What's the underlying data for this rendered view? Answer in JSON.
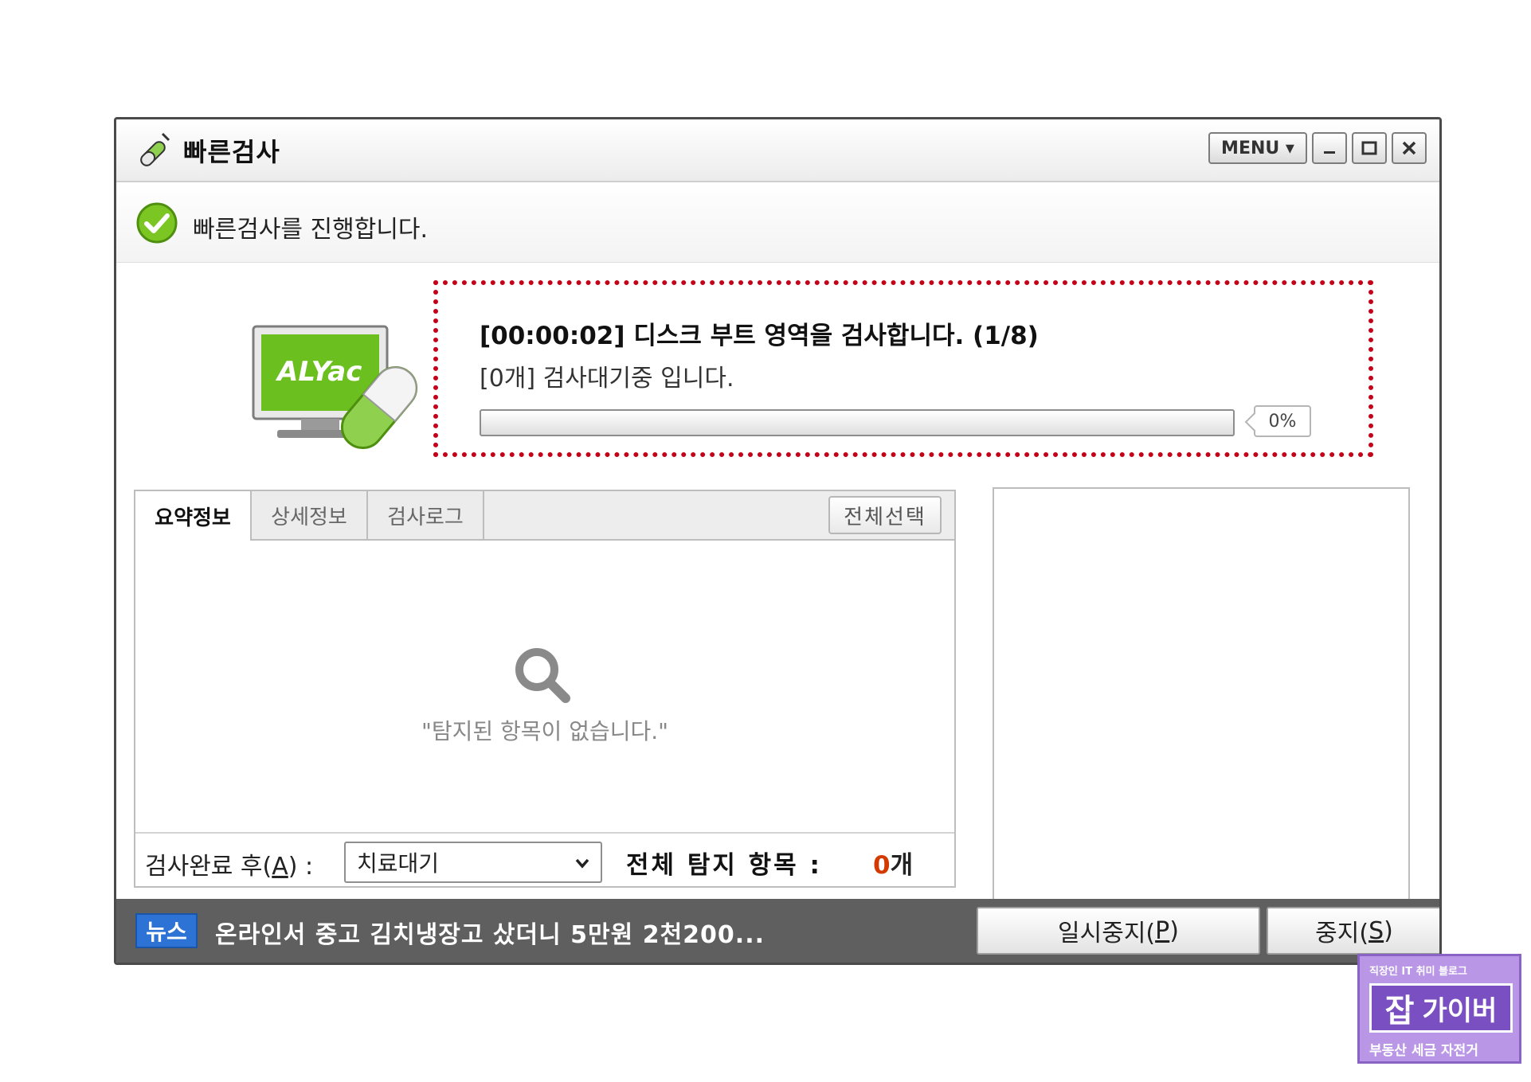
{
  "window": {
    "title": "빠른검사",
    "menu_label": "MENU ▾",
    "minimize_label": "_",
    "maximize_label": "□",
    "close_label": "✕"
  },
  "status": {
    "message": "빠른검사를 진행합니다."
  },
  "logo": {
    "text": "ALYac"
  },
  "progress": {
    "scan_line": "[00:00:02] 디스크 부트 영역을 검사합니다. (1/8)",
    "wait_line": "[0개] 검사대기중 입니다.",
    "percent_label": "0%",
    "percent_value": 0
  },
  "tabs": [
    {
      "label": "요약정보",
      "active": true
    },
    {
      "label": "상세정보",
      "active": false
    },
    {
      "label": "검사로그",
      "active": false
    }
  ],
  "select_all_label": "전체선택",
  "empty_message": "\"탐지된 항목이 없습니다.\"",
  "after_scan": {
    "label_prefix": "검사완료 후(",
    "label_key": "A",
    "label_suffix": ") :",
    "selected_option": "치료대기"
  },
  "total": {
    "label": "전체 탐지 항목 :",
    "count": "0",
    "unit": "개"
  },
  "footer": {
    "news_badge": "뉴스",
    "news_text": "온라인서 중고 김치냉장고 샀더니 5만원 2천200...",
    "pause_prefix": "일시중지(",
    "pause_key": "P",
    "pause_suffix": ")",
    "stop_prefix": "중지(",
    "stop_key": "S",
    "stop_suffix": ")"
  },
  "watermark": {
    "top": "직장인 IT 취미 블로그",
    "jab": "잡",
    "name": "가이버",
    "bottom": "부동산 세금 자전거"
  },
  "colors": {
    "alert_red": "#c40018",
    "count_orange": "#d23a00",
    "news_blue": "#2d73d6",
    "footer_gray": "#5f5f5f",
    "logo_green": "#6bbf1f"
  }
}
